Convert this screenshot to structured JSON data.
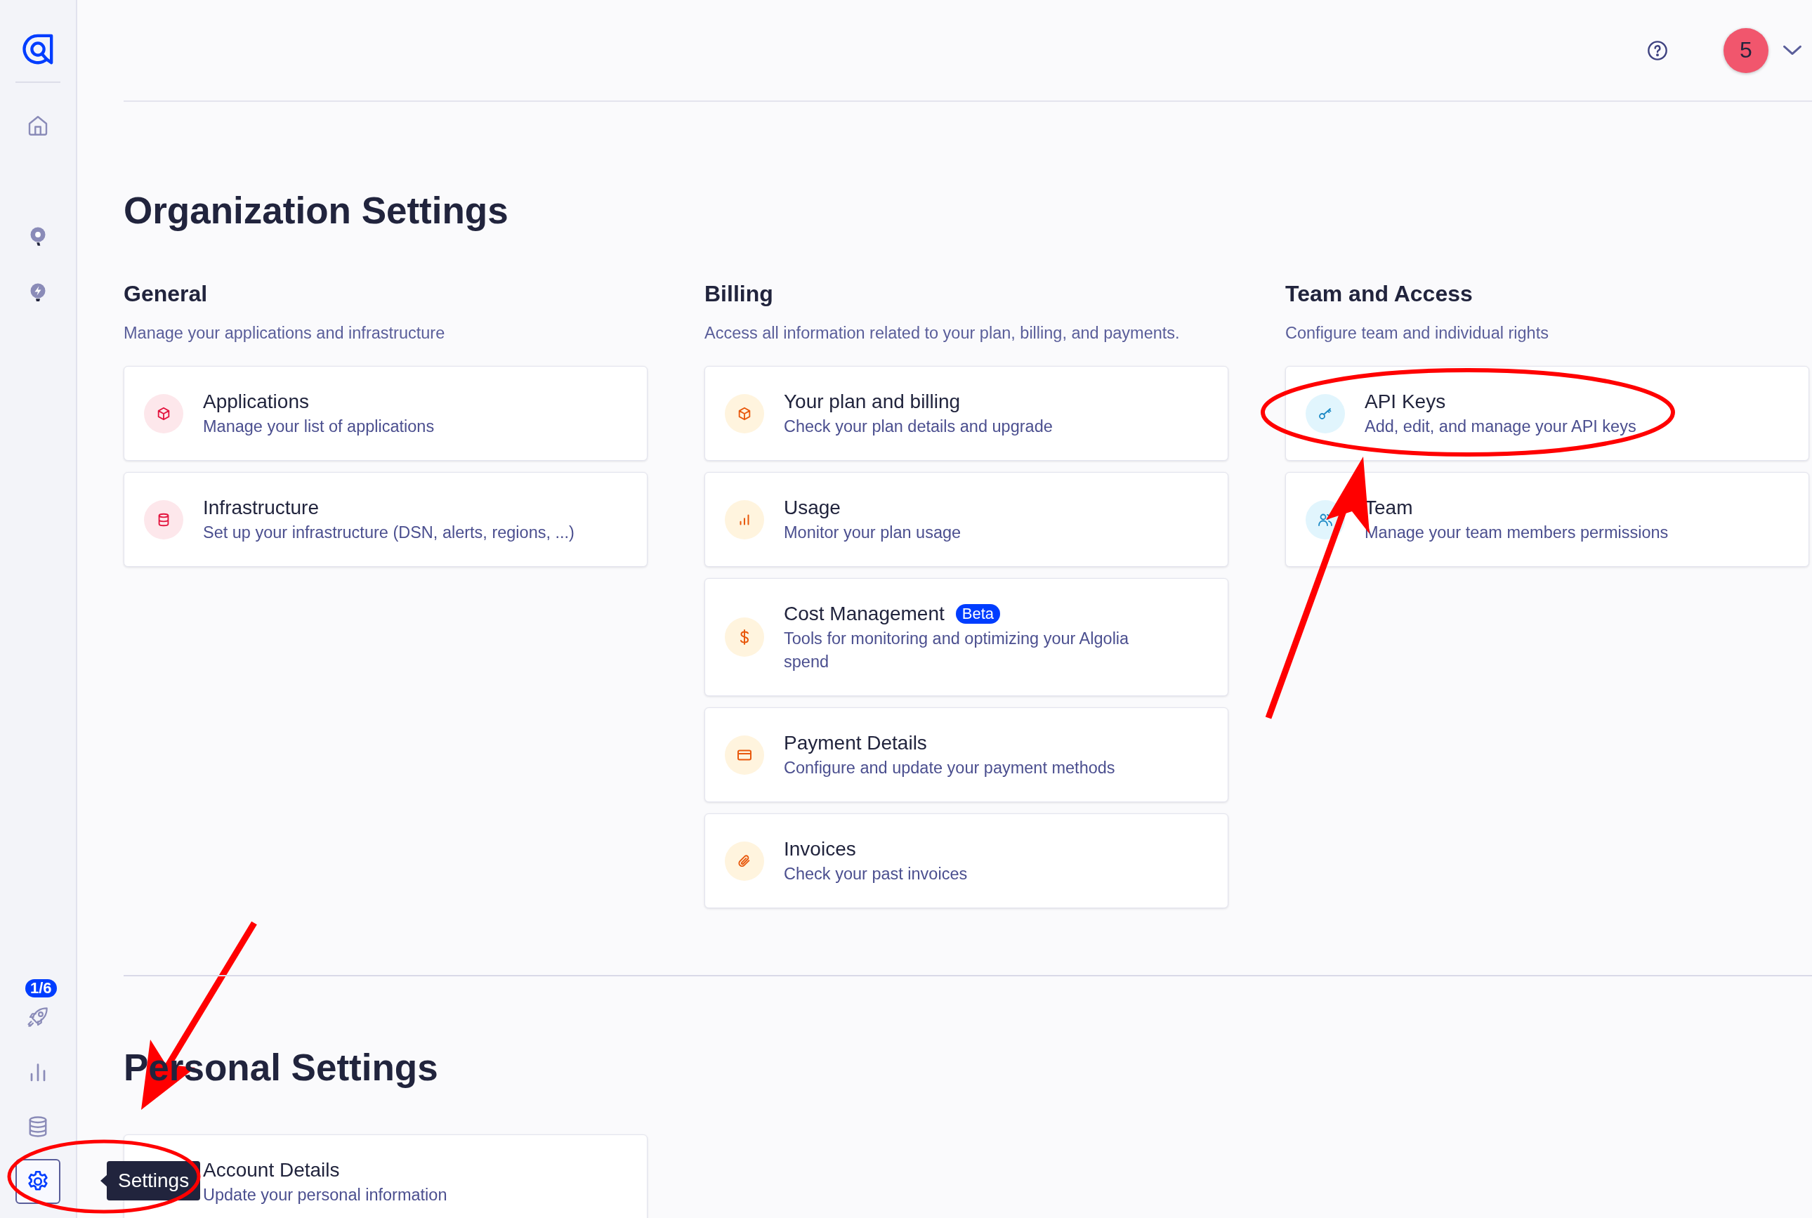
{
  "sidebar": {
    "top_items": [
      {
        "selected": false
      },
      {
        "selected": false
      },
      {
        "selected": false
      }
    ],
    "bottom_items": [
      {
        "selected": false,
        "badge": "1/6"
      },
      {
        "selected": false
      },
      {
        "selected": false
      },
      {
        "selected": true
      }
    ]
  },
  "tooltip": "Settings",
  "header": {
    "avatar": "5"
  },
  "sections": [
    {
      "title": "Organization Settings",
      "groups": [
        {
          "heading": "General",
          "description": "Manage your applications and infrastructure",
          "cards": [
            {
              "title": "Applications",
              "subtitle": "Manage your list of applications"
            },
            {
              "title": "Infrastructure",
              "subtitle": "Set up your infrastructure (DSN, alerts, regions, ...)"
            }
          ]
        },
        {
          "heading": "Billing",
          "description": "Access all information related to your plan, billing, and payments.",
          "cards": [
            {
              "title": "Your plan and billing",
              "subtitle": "Check your plan details and upgrade"
            },
            {
              "title": "Usage",
              "subtitle": "Monitor your plan usage"
            },
            {
              "title": "Cost Management",
              "badge": "Beta",
              "subtitle": "Tools for monitoring and optimizing your Algolia spend"
            },
            {
              "title": "Payment Details",
              "subtitle": "Configure and update your payment methods"
            },
            {
              "title": "Invoices",
              "subtitle": "Check your past invoices"
            }
          ]
        },
        {
          "heading": "Team and Access",
          "description": "Configure team and individual rights",
          "cards": [
            {
              "title": "API Keys",
              "subtitle": "Add, edit, and manage your API keys"
            },
            {
              "title": "Team",
              "subtitle": "Manage your team members permissions"
            }
          ]
        }
      ]
    },
    {
      "title": "Personal Settings",
      "groups": [
        {
          "cards": [
            {
              "title": "Account Details",
              "subtitle": "Update your personal information"
            }
          ]
        }
      ]
    }
  ]
}
